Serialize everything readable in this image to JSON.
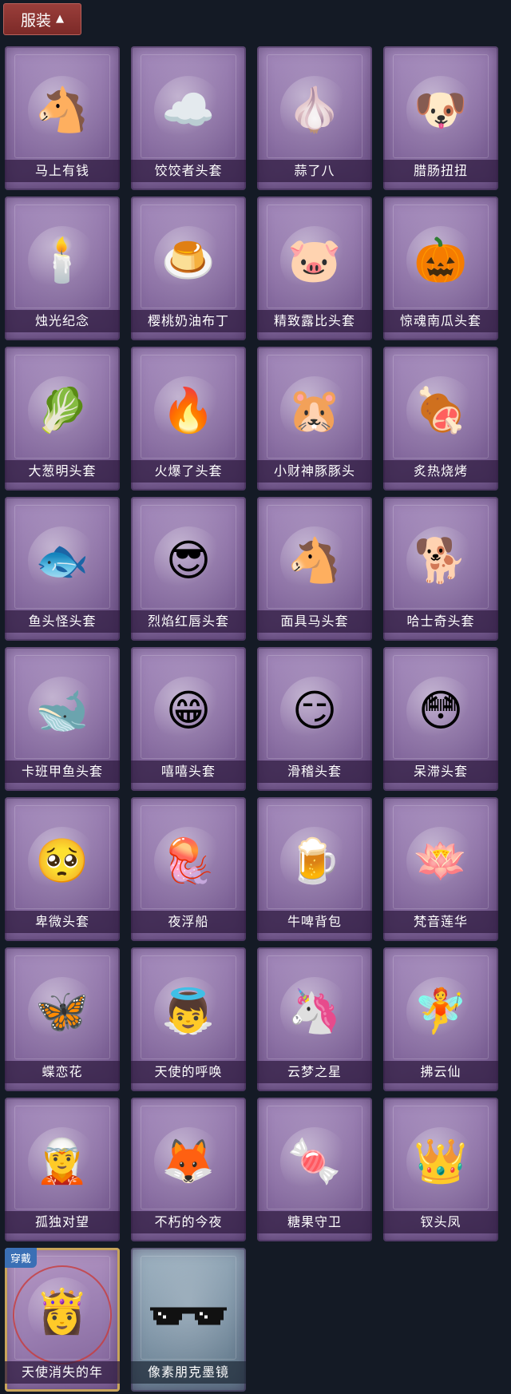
{
  "header": {
    "label": "服装",
    "icon": "chevron-up-icon"
  },
  "items": [
    {
      "name": "马上有钱",
      "icon": "🐴"
    },
    {
      "name": "饺饺者头套",
      "icon": "☁️"
    },
    {
      "name": "蒜了八",
      "icon": "🧄"
    },
    {
      "name": "腊肠扭扭",
      "icon": "🐶"
    },
    {
      "name": "烛光纪念",
      "icon": "🕯️"
    },
    {
      "name": "樱桃奶油布丁",
      "icon": "🍮"
    },
    {
      "name": "精致露比头套",
      "icon": "🐷"
    },
    {
      "name": "惊魂南瓜头套",
      "icon": "🎃"
    },
    {
      "name": "大葱明头套",
      "icon": "🥬"
    },
    {
      "name": "火爆了头套",
      "icon": "🔥"
    },
    {
      "name": "小财神豚豚头",
      "icon": "🐹"
    },
    {
      "name": "炙热烧烤",
      "icon": "🍖"
    },
    {
      "name": "鱼头怪头套",
      "icon": "🐟"
    },
    {
      "name": "烈焰红唇头套",
      "icon": "😎"
    },
    {
      "name": "面具马头套",
      "icon": "🐴"
    },
    {
      "name": "哈士奇头套",
      "icon": "🐕"
    },
    {
      "name": "卡班甲鱼头套",
      "icon": "🐋"
    },
    {
      "name": "嘻嘻头套",
      "icon": "😁"
    },
    {
      "name": "滑稽头套",
      "icon": "😏"
    },
    {
      "name": "呆滞头套",
      "icon": "😳"
    },
    {
      "name": "卑微头套",
      "icon": "🥺"
    },
    {
      "name": "夜浮船",
      "icon": "🪼"
    },
    {
      "name": "牛啤背包",
      "icon": "🍺"
    },
    {
      "name": "梵音莲华",
      "icon": "🪷"
    },
    {
      "name": "蝶恋花",
      "icon": "🦋"
    },
    {
      "name": "天使的呼唤",
      "icon": "👼"
    },
    {
      "name": "云梦之星",
      "icon": "🦄"
    },
    {
      "name": "拂云仙",
      "icon": "🧚"
    },
    {
      "name": "孤独对望",
      "icon": "🧝"
    },
    {
      "name": "不朽的今夜",
      "icon": "🦊"
    },
    {
      "name": "糖果守卫",
      "icon": "🍬"
    },
    {
      "name": "钗头凤",
      "icon": "👑"
    }
  ],
  "equipped": {
    "name": "天使消失的年",
    "badge": "穿戴",
    "icon": "👸"
  },
  "last": {
    "name": "像素朋克墨镜",
    "icon": "pixel-sunglasses-icon"
  }
}
